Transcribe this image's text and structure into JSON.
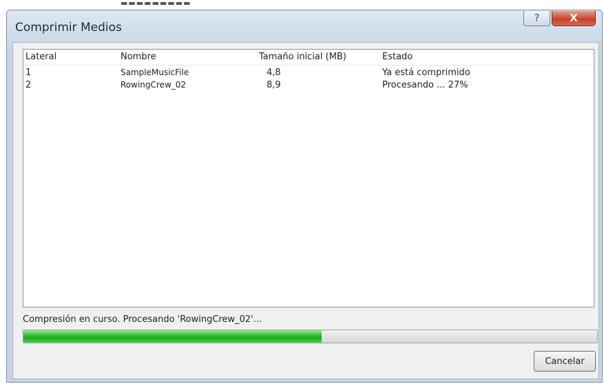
{
  "dialog": {
    "title": "Comprimir Medios",
    "help_glyph": "?",
    "close_glyph": "X"
  },
  "table": {
    "columns": [
      "Lateral",
      "Nombre",
      "Tamaño inicial (MB)",
      "Estado"
    ],
    "rows": [
      {
        "lateral": "1",
        "nombre": "SampleMusicFile",
        "tamano": "4,8",
        "estado": "Ya está comprimido"
      },
      {
        "lateral": "2",
        "nombre": "RowingCrew_02",
        "tamano": "8,9",
        "estado": "Procesando ... 27%"
      }
    ]
  },
  "status": {
    "message": "Compresión en curso. Procesando 'RowingCrew_02'...",
    "progress_fraction": 0.52
  },
  "buttons": {
    "cancel_label": "Cancelar"
  },
  "colors": {
    "progress_green": "#1aa81a",
    "close_red": "#c2412a",
    "frame_blue": "#cdd9e6"
  },
  "icons": {
    "help": "help-icon",
    "close": "close-icon"
  }
}
